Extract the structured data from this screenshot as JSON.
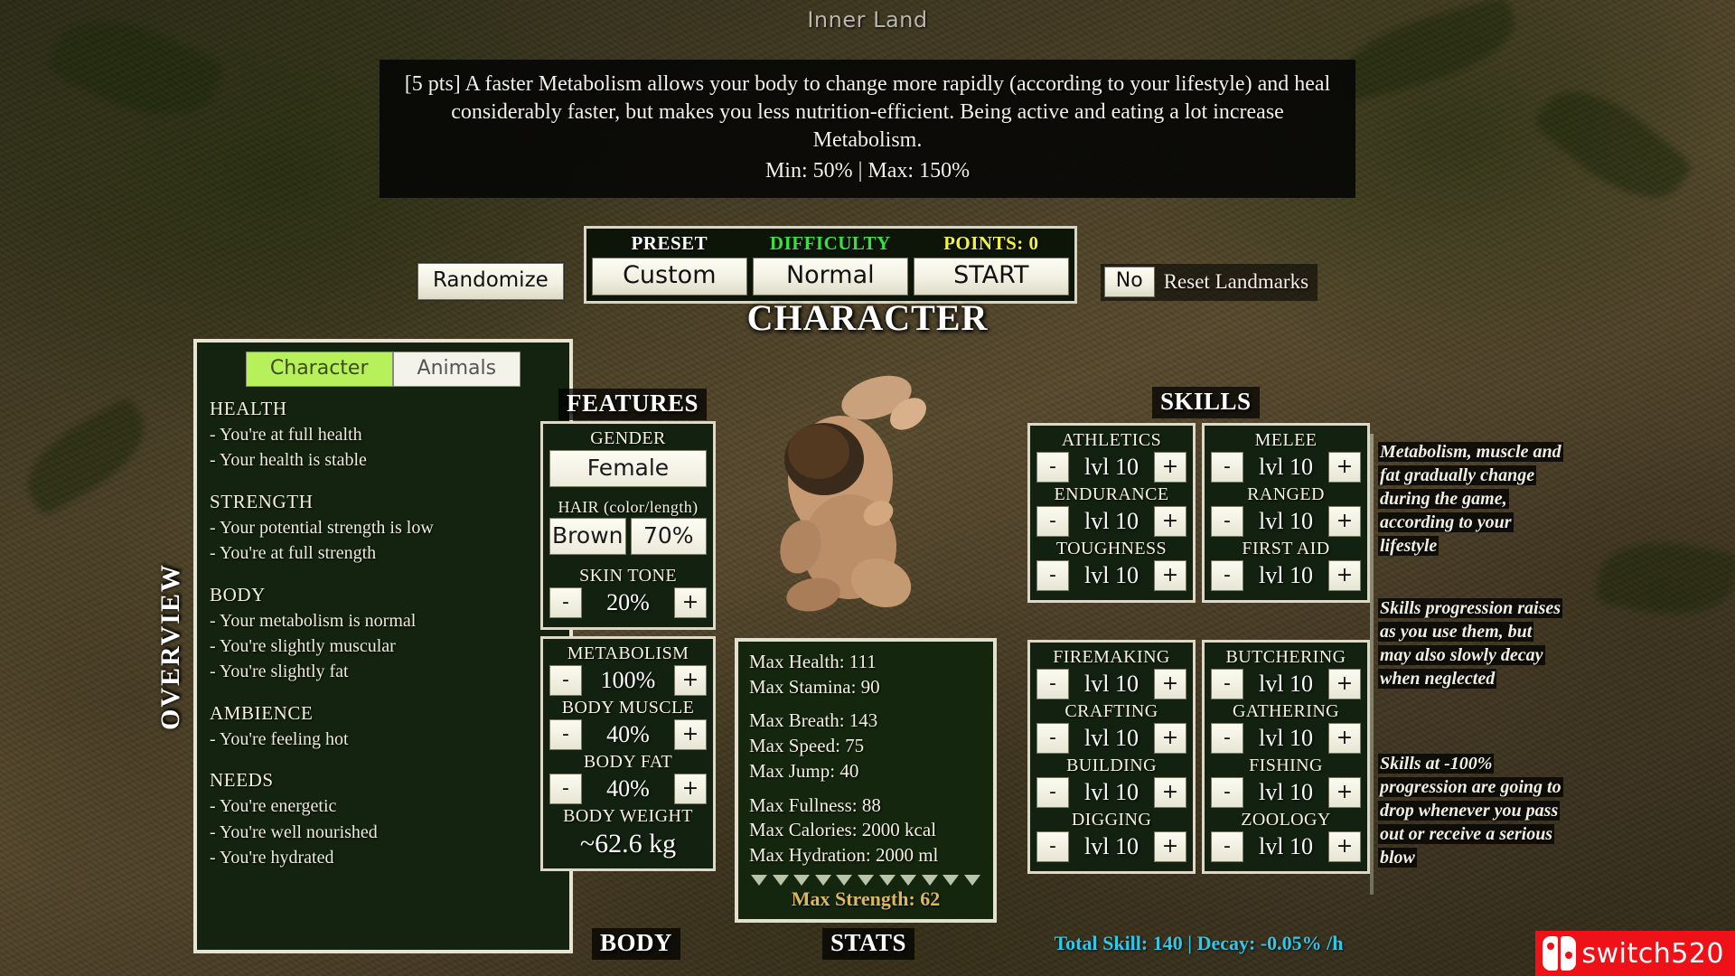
{
  "window": {
    "game_title": "Inner Land"
  },
  "tooltip": {
    "body": "[5 pts] A faster Metabolism allows your body to change more rapidly (according to your lifestyle) and heal considerably faster, but makes you less nutrition-efficient. Being active and eating a lot increase Metabolism.",
    "minmax": "Min: 50% | Max: 150%"
  },
  "controls": {
    "randomize_label": "Randomize",
    "preset_header": "PRESET",
    "preset_value": "Custom",
    "difficulty_header": "DIFFICULTY",
    "difficulty_value": "Normal",
    "points_header": "POINTS: 0",
    "start_label": "START",
    "reset_toggle": "No",
    "reset_label": "Reset Landmarks"
  },
  "page": {
    "heading": "CHARACTER"
  },
  "overview": {
    "label": "OVERVIEW",
    "tabs": [
      {
        "label": "Character",
        "active": true
      },
      {
        "label": "Animals",
        "active": false
      }
    ],
    "groups": [
      {
        "title": "HEALTH",
        "lines": [
          "- You're at full health",
          "- Your health is stable"
        ]
      },
      {
        "title": "STRENGTH",
        "lines": [
          "- Your potential strength is low",
          "- You're at full strength"
        ]
      },
      {
        "title": "BODY",
        "lines": [
          "- Your metabolism is normal",
          "- You're slightly muscular",
          "- You're slightly fat"
        ]
      },
      {
        "title": "AMBIENCE",
        "lines": [
          "- You're feeling hot"
        ]
      },
      {
        "title": "NEEDS",
        "lines": [
          "- You're energetic",
          "- You're well nourished",
          "- You're hydrated"
        ]
      }
    ]
  },
  "features": {
    "title": "FEATURES",
    "gender_label": "GENDER",
    "gender_value": "Female",
    "hair_label": "HAIR (color/length)",
    "hair_color": "Brown",
    "hair_length": "70%",
    "skin_label": "SKIN TONE",
    "skin_value": "20%",
    "minus": "-",
    "plus": "+"
  },
  "body": {
    "title": "BODY",
    "rows": [
      {
        "label": "METABOLISM",
        "value": "100%"
      },
      {
        "label": "BODY MUSCLE",
        "value": "40%"
      },
      {
        "label": "BODY FAT",
        "value": "40%"
      }
    ],
    "weight_label": "BODY WEIGHT",
    "weight_value": "~62.6 kg",
    "minus": "-",
    "plus": "+"
  },
  "stats": {
    "title": "STATS",
    "group1": [
      "Max Health: 111",
      "Max Stamina: 90"
    ],
    "group2": [
      "Max Breath: 143",
      "Max Speed: 75",
      "Max Jump: 40"
    ],
    "group3": [
      "Max Fullness: 88",
      "Max Calories: 2000 kcal",
      "Max Hydration: 2000 ml"
    ],
    "arrow_count": 11,
    "max_strength": "Max Strength: 62"
  },
  "skills": {
    "title": "SKILLS",
    "minus": "-",
    "plus": "+",
    "col1a": [
      {
        "label": "ATHLETICS",
        "value": "lvl 10"
      },
      {
        "label": "ENDURANCE",
        "value": "lvl 10"
      },
      {
        "label": "TOUGHNESS",
        "value": "lvl 10"
      }
    ],
    "col2a": [
      {
        "label": "MELEE",
        "value": "lvl 10"
      },
      {
        "label": "RANGED",
        "value": "lvl 10"
      },
      {
        "label": "FIRST AID",
        "value": "lvl 10"
      }
    ],
    "col1b": [
      {
        "label": "FIREMAKING",
        "value": "lvl 10"
      },
      {
        "label": "CRAFTING",
        "value": "lvl 10"
      },
      {
        "label": "BUILDING",
        "value": "lvl 10"
      },
      {
        "label": "DIGGING",
        "value": "lvl 10"
      }
    ],
    "col2b": [
      {
        "label": "BUTCHERING",
        "value": "lvl 10"
      },
      {
        "label": "GATHERING",
        "value": "lvl 10"
      },
      {
        "label": "FISHING",
        "value": "lvl 10"
      },
      {
        "label": "ZOOLOGY",
        "value": "lvl 10"
      }
    ],
    "total": "Total Skill: 140 | Decay: -0.05% /h"
  },
  "hints": [
    "Metabolism, muscle and fat gradually change during the game, according to your lifestyle",
    "Skills progression raises as you use them, but may also slowly decay when neglected",
    "Skills at -100% progression are going to drop whenever you pass out or receive a serious blow"
  ],
  "watermark": {
    "text": "switch520"
  },
  "colors": {
    "accent_green": "#36e23c",
    "accent_yellow": "#f4f23a",
    "accent_cyan": "#2ec8e8",
    "accent_gold": "#d9b860",
    "tab_active": "#b6f05a",
    "watermark_red": "#ef1118"
  }
}
